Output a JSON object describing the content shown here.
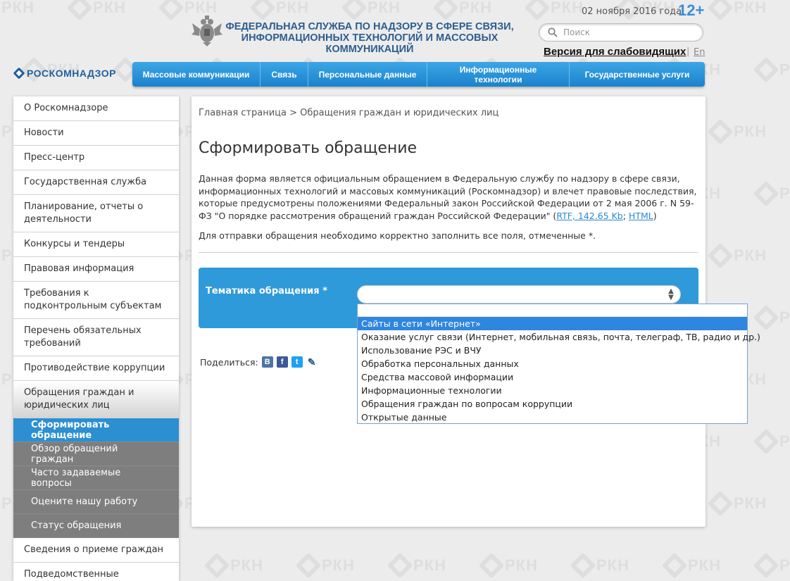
{
  "header": {
    "title_line1": "ФЕДЕРАЛЬНАЯ СЛУЖБА ПО НАДЗОРУ В СФЕРЕ СВЯЗИ,",
    "title_line2": "ИНФОРМАЦИОННЫХ ТЕХНОЛОГИЙ И МАССОВЫХ КОММУНИКАЦИЙ",
    "date": "02 ноября 2016 года",
    "age_rating": "12+",
    "search_placeholder": "Поиск",
    "low_vision_link": "Версия для слабовидящих",
    "separator": "|",
    "lang_link": "En",
    "logo_text": "РОСКОМНАДЗОР",
    "watermark_text": "РКН"
  },
  "nav": {
    "items": [
      {
        "label": "Массовые коммуникации"
      },
      {
        "label": "Связь"
      },
      {
        "label": "Персональные данные"
      },
      {
        "label": "Информационные технологии"
      },
      {
        "label": "Государственные услуги"
      }
    ]
  },
  "sidebar": {
    "items": [
      {
        "label": "О Роскомнадзоре"
      },
      {
        "label": "Новости"
      },
      {
        "label": "Пресс-центр"
      },
      {
        "label": "Государственная служба"
      },
      {
        "label": "Планирование, отчеты о деятельности"
      },
      {
        "label": "Конкурсы и тендеры"
      },
      {
        "label": "Правовая информация"
      },
      {
        "label": "Требования к подконтрольным субъектам"
      },
      {
        "label": "Перечень обязательных требований"
      },
      {
        "label": "Противодействие коррупции"
      },
      {
        "label": "Обращения граждан и юридических лиц"
      }
    ],
    "subitems": [
      {
        "label": "Сформировать обращение"
      },
      {
        "label": "Обзор обращений граждан"
      },
      {
        "label": "Часто задаваемые вопросы"
      },
      {
        "label": "Оцените нашу работу"
      },
      {
        "label": "Статус обращения"
      }
    ],
    "after": [
      {
        "label": "Сведения о приеме граждан"
      },
      {
        "label": "Подведомственные"
      }
    ]
  },
  "main": {
    "breadcrumb_home": "Главная страница",
    "breadcrumb_sep": " > ",
    "breadcrumb_current": "Обращения граждан и юридических лиц",
    "title": "Сформировать обращение",
    "intro": "Данная форма является официальным обращением в Федеральную службу по надзору в сфере связи, информационных технологий и массовых коммуникаций (Роскомнадзор) и влечет правовые последствия, которые предусмотрены положениями Федеральный закон Российской Федерации от 2 мая 2006 г. N 59-ФЗ \"О порядке рассмотрения обращений граждан Российской Федерации\" (",
    "rtf_link": "RTF, 142.65 Kb",
    "link_sep": "; ",
    "html_link": "HTML",
    "intro_end": ")",
    "required_note": "Для отправки обращения необходимо корректно заполнить все поля, отмеченные *.",
    "topic_label": "Тематика обращения *",
    "select_arrows": "▲▼",
    "topic_options": [
      "Сайты в сети «Интернет»",
      "Оказание услуг связи (Интернет, мобильная связь, почта, телеграф, ТВ, радио и др.)",
      "Использование РЭС и ВЧУ",
      "Обработка персональных данных",
      "Средства массовой информации",
      "Информационные технологии",
      "Обращения граждан по вопросам коррупции",
      "Открытые данные"
    ],
    "highlighted_option_index": 0,
    "share_label": "Поделиться:",
    "share_icons": [
      {
        "name": "vk-icon",
        "glyph": "В",
        "color": "#4c75a3"
      },
      {
        "name": "facebook-icon",
        "glyph": "f",
        "color": "#3b5998"
      },
      {
        "name": "twitter-icon",
        "glyph": "t",
        "color": "#1da1f2"
      },
      {
        "name": "livejournal-icon",
        "glyph": "✎",
        "color": "#2b5e87"
      }
    ]
  }
}
